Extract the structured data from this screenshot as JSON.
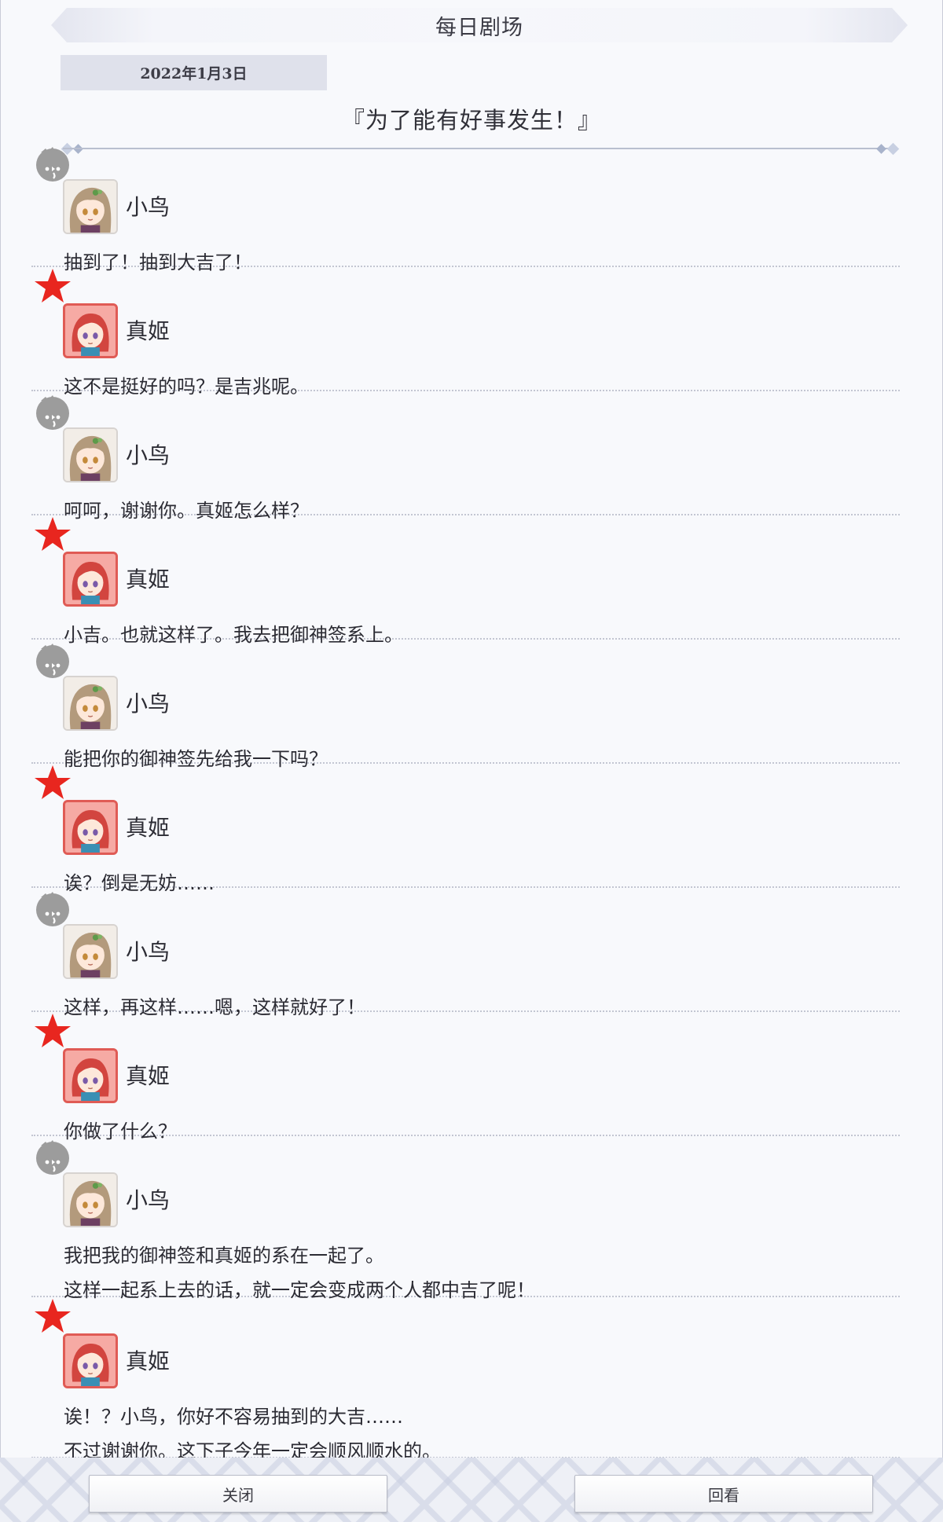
{
  "header": {
    "title": "每日剧场"
  },
  "story": {
    "date": "2022年1月3日",
    "title": "『为了能有好事发生！』"
  },
  "characters": {
    "kotori": {
      "name": "小鸟",
      "badge_icon": "bird-icon",
      "badge_color": "#9e9e9e"
    },
    "maki": {
      "name": "真姬",
      "badge_icon": "star-icon",
      "badge_color": "#e8261f"
    }
  },
  "dialogue": [
    {
      "speaker": "小鸟",
      "lines": [
        "抽到了！抽到大吉了！"
      ]
    },
    {
      "speaker": "真姬",
      "lines": [
        "这不是挺好的吗？是吉兆呢。"
      ]
    },
    {
      "speaker": "小鸟",
      "lines": [
        "呵呵，谢谢你。真姬怎么样？"
      ]
    },
    {
      "speaker": "真姬",
      "lines": [
        "小吉。也就这样了。我去把御神签系上。"
      ]
    },
    {
      "speaker": "小鸟",
      "lines": [
        "能把你的御神签先给我一下吗？"
      ]
    },
    {
      "speaker": "真姬",
      "lines": [
        "诶？倒是无妨……"
      ]
    },
    {
      "speaker": "小鸟",
      "lines": [
        "这样，再这样……嗯，这样就好了！"
      ]
    },
    {
      "speaker": "真姬",
      "lines": [
        "你做了什么？"
      ]
    },
    {
      "speaker": "小鸟",
      "lines": [
        "我把我的御神签和真姬的系在一起了。",
        "这样一起系上去的话，就一定会变成两个人都中吉了呢！"
      ]
    },
    {
      "speaker": "真姬",
      "lines": [
        "诶！？小鸟，你好不容易抽到的大吉……",
        "不过谢谢你。这下子今年一定会顺风顺水的。"
      ]
    }
  ],
  "buttons": {
    "close": "关闭",
    "replay": "回看"
  }
}
